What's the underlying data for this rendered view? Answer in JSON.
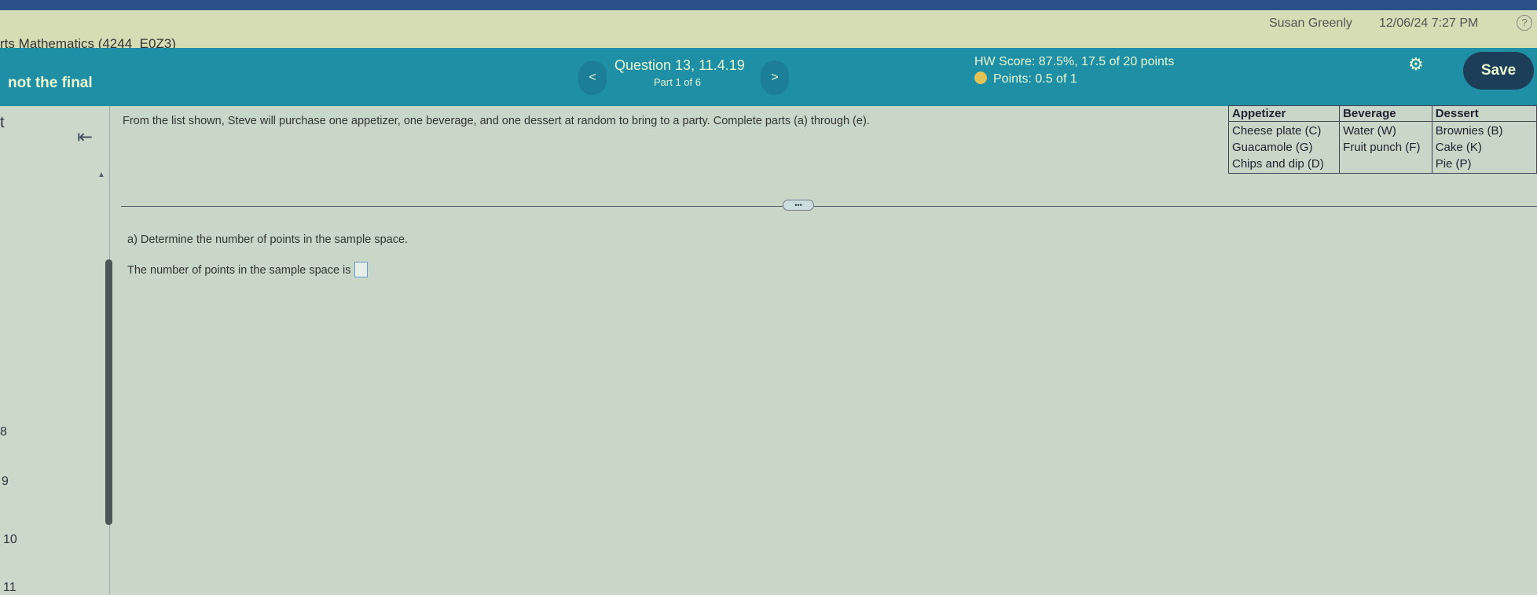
{
  "header": {
    "course": "rts Mathematics (4244_E0Z3)",
    "user": "Susan Greenly",
    "datetime": "12/06/24 7:27 PM",
    "help_icon": "?"
  },
  "toolbar": {
    "left_text": "not the final",
    "question": "Question 13, 11.4.19",
    "part": "Part 1 of 6",
    "hw_score": "HW Score: 87.5%, 17.5 of 20 points",
    "points": "Points: 0.5 of 1",
    "save": "Save",
    "prev": "<",
    "next": ">"
  },
  "sidebar": {
    "partial_label": "t",
    "items": [
      "8",
      "9",
      "10",
      "11"
    ]
  },
  "question": {
    "text": "From the list shown, Steve will purchase one appetizer, one beverage, and one dessert at random to bring to a party. Complete parts (a) through (e).",
    "table": {
      "headers": [
        "Appetizer",
        "Beverage",
        "Dessert"
      ],
      "columns": [
        [
          "Cheese plate (C)",
          "Guacamole (G)",
          "Chips and dip (D)"
        ],
        [
          "Water (W)",
          "Fruit punch (F)"
        ],
        [
          "Brownies (B)",
          "Cake (K)",
          "Pie (P)"
        ]
      ]
    },
    "more": "•••",
    "part_a": "a) Determine the number of points in the sample space.",
    "answer_prompt": "The number of points in the sample space is",
    "answer_value": ""
  }
}
